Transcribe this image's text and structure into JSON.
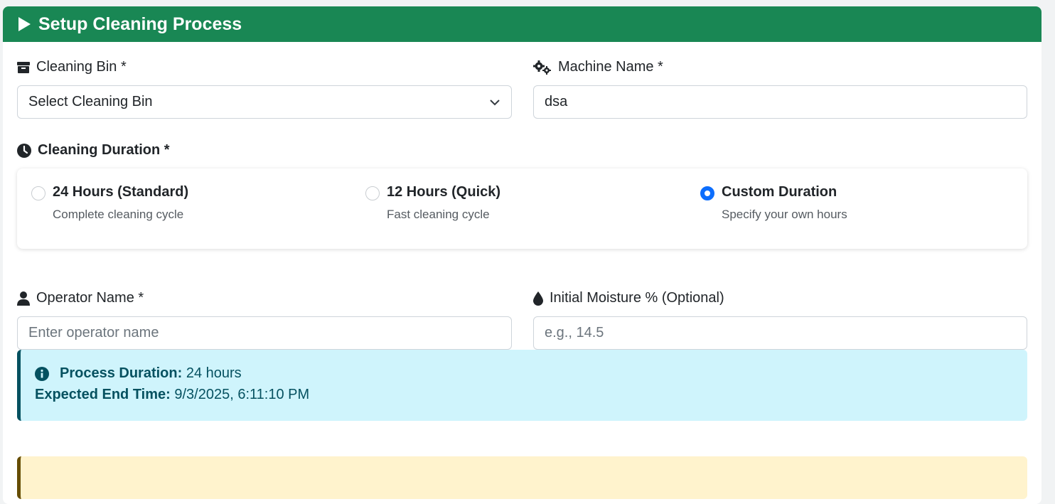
{
  "header": {
    "title": "Setup Cleaning Process",
    "icon": "play-icon"
  },
  "cleaning_bin": {
    "label": "Cleaning Bin *",
    "icon": "box-icon",
    "selected": "Select Cleaning Bin"
  },
  "machine_name": {
    "label": "Machine Name *",
    "icon": "gears-icon",
    "value": "dsa"
  },
  "duration": {
    "label": "Cleaning Duration *",
    "icon": "clock-icon",
    "options": [
      {
        "title": "24 Hours (Standard)",
        "desc": "Complete cleaning cycle",
        "checked": false
      },
      {
        "title": "12 Hours (Quick)",
        "desc": "Fast cleaning cycle",
        "checked": false
      },
      {
        "title": "Custom Duration",
        "desc": "Specify your own hours",
        "checked": true
      }
    ]
  },
  "operator": {
    "label": "Operator Name *",
    "icon": "user-icon",
    "placeholder": "Enter operator name"
  },
  "moisture": {
    "label": "Initial Moisture % (Optional)",
    "icon": "droplet-icon",
    "placeholder": "e.g., 14.5"
  },
  "info": {
    "icon": "info-circle-icon",
    "duration_label": "Process Duration:",
    "duration_value": "24 hours",
    "end_label": "Expected End Time:",
    "end_value": "9/3/2025, 6:11:10 PM"
  },
  "colors": {
    "header_bg": "#198754",
    "radio_checked": "#0d6efd",
    "info_bg": "#cff4fc",
    "info_text": "#055160",
    "warning_bg": "#fff3cd"
  }
}
